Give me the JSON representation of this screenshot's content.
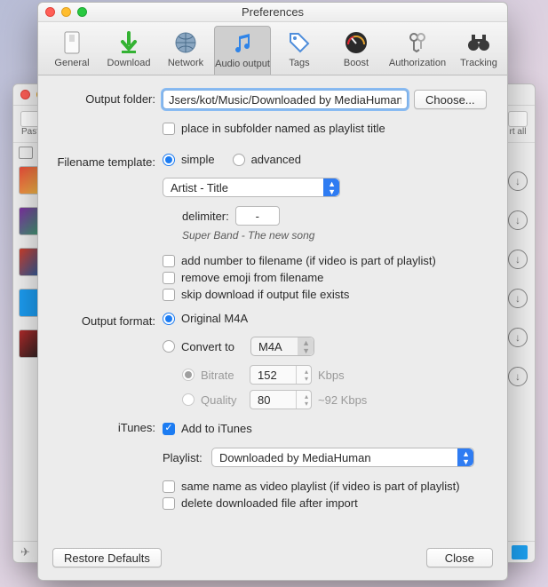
{
  "window": {
    "title": "Preferences"
  },
  "tabs": {
    "general": "General",
    "download": "Download",
    "network": "Network",
    "audio_output": "Audio output",
    "tags": "Tags",
    "boost": "Boost",
    "authorization": "Authorization",
    "tracking": "Tracking"
  },
  "output_folder": {
    "label": "Output folder:",
    "path": "Jsers/kot/Music/Downloaded by MediaHuman",
    "choose": "Choose...",
    "subfolder_checkbox": "place in subfolder named as playlist title"
  },
  "filename_template": {
    "label": "Filename template:",
    "simple": "simple",
    "advanced": "advanced",
    "pattern": "Artist - Title",
    "delimiter_label": "delimiter:",
    "delimiter_value": "-",
    "example": "Super Band - The new song",
    "add_number": "add number to filename (if video is part of playlist)",
    "remove_emoji": "remove emoji from filename",
    "skip_exists": "skip download if output file exists"
  },
  "output_format": {
    "label": "Output format:",
    "original": "Original M4A",
    "convert_to": "Convert to",
    "convert_format": "M4A",
    "bitrate_label": "Bitrate",
    "bitrate_value": "152",
    "bitrate_unit": "Kbps",
    "quality_label": "Quality",
    "quality_value": "80",
    "quality_hint": "~92 Kbps"
  },
  "itunes": {
    "label": "iTunes:",
    "add": "Add to iTunes",
    "playlist_label": "Playlist:",
    "playlist_value": "Downloaded by MediaHuman",
    "same_name": "same name as video playlist (if video is part of playlist)",
    "delete_after": "delete downloaded file after import"
  },
  "footer": {
    "restore": "Restore Defaults",
    "close": "Close"
  },
  "back": {
    "paste": "Past",
    "rtall": "rt all"
  }
}
